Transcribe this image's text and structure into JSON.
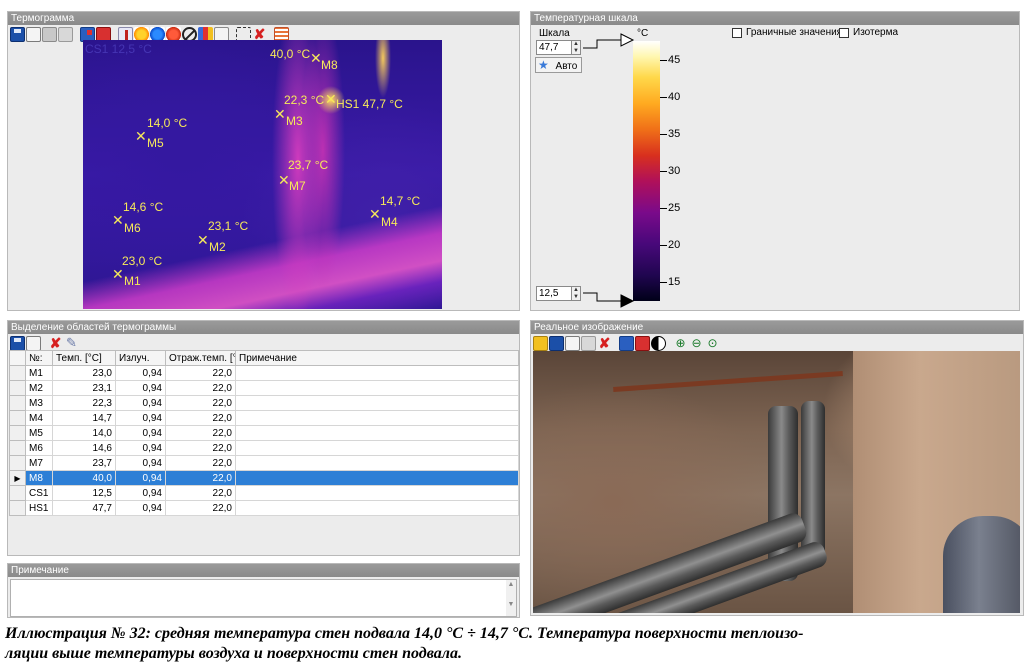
{
  "thermogram": {
    "title": "Термограмма",
    "markers": [
      {
        "id": "M1",
        "temp": "23,0 °C"
      },
      {
        "id": "M2",
        "temp": "23,1 °C"
      },
      {
        "id": "M3",
        "temp": "22,3 °C"
      },
      {
        "id": "M4",
        "temp": "14,7 °C"
      },
      {
        "id": "M5",
        "temp": "14,0 °C"
      },
      {
        "id": "M6",
        "temp": "14,6 °C"
      },
      {
        "id": "M7",
        "temp": "23,7 °C"
      },
      {
        "id": "M8",
        "temp": "40,0 °C"
      },
      {
        "id": "HS1",
        "temp": "47,7 °C",
        "label": "HS1 47,7 °C"
      }
    ],
    "cs_label": "CS1 12,5 °C"
  },
  "scale": {
    "title": "Температурная шкала",
    "scale_label": "Шкала",
    "unit": "°C",
    "max_value": "47,7",
    "min_value": "12,5",
    "auto_button": "Авто",
    "boundary_label": "Граничные значения",
    "isotherm_label": "Изотерма",
    "ticks": [
      "45",
      "40",
      "35",
      "30",
      "25",
      "20",
      "15"
    ]
  },
  "regions": {
    "title": "Выделение областей термограммы",
    "columns": [
      "№:",
      "Темп. [°C]",
      "Излуч.",
      "Отраж.темп. [°",
      "Примечание"
    ],
    "rows": [
      {
        "id": "M1",
        "temp": "23,0",
        "emis": "0,94",
        "refl": "22,0",
        "note": ""
      },
      {
        "id": "M2",
        "temp": "23,1",
        "emis": "0,94",
        "refl": "22,0",
        "note": ""
      },
      {
        "id": "M3",
        "temp": "22,3",
        "emis": "0,94",
        "refl": "22,0",
        "note": ""
      },
      {
        "id": "M4",
        "temp": "14,7",
        "emis": "0,94",
        "refl": "22,0",
        "note": ""
      },
      {
        "id": "M5",
        "temp": "14,0",
        "emis": "0,94",
        "refl": "22,0",
        "note": ""
      },
      {
        "id": "M6",
        "temp": "14,6",
        "emis": "0,94",
        "refl": "22,0",
        "note": ""
      },
      {
        "id": "M7",
        "temp": "23,7",
        "emis": "0,94",
        "refl": "22,0",
        "note": ""
      },
      {
        "id": "M8",
        "temp": "40,0",
        "emis": "0,94",
        "refl": "22,0",
        "note": ""
      },
      {
        "id": "CS1",
        "temp": "12,5",
        "emis": "0,94",
        "refl": "22,0",
        "note": ""
      },
      {
        "id": "HS1",
        "temp": "47,7",
        "emis": "0,94",
        "refl": "22,0",
        "note": ""
      }
    ],
    "selected_row": "M8"
  },
  "note": {
    "title": "Примечание",
    "value": ""
  },
  "photo": {
    "title": "Реальное изображение"
  },
  "caption": "Иллюстрация № 32: средняя температура стен подвала 14,0 °C ÷ 14,7 °C. Температура поверхности теплоизоляции выше температуры воздуха и поверхности стен подвала.",
  "caption_lines": [
    "Иллюстрация № 32: средняя температура стен подвала 14,0 °C ÷ 14,7 °C. Температура поверхности теплоизо-",
    "ляции выше температуры воздуха и поверхности стен подвала."
  ],
  "colors": {
    "selection": "#2d7fd6",
    "marker": "#f7ea5a",
    "panel_title_bg": "#8f8f8f"
  }
}
